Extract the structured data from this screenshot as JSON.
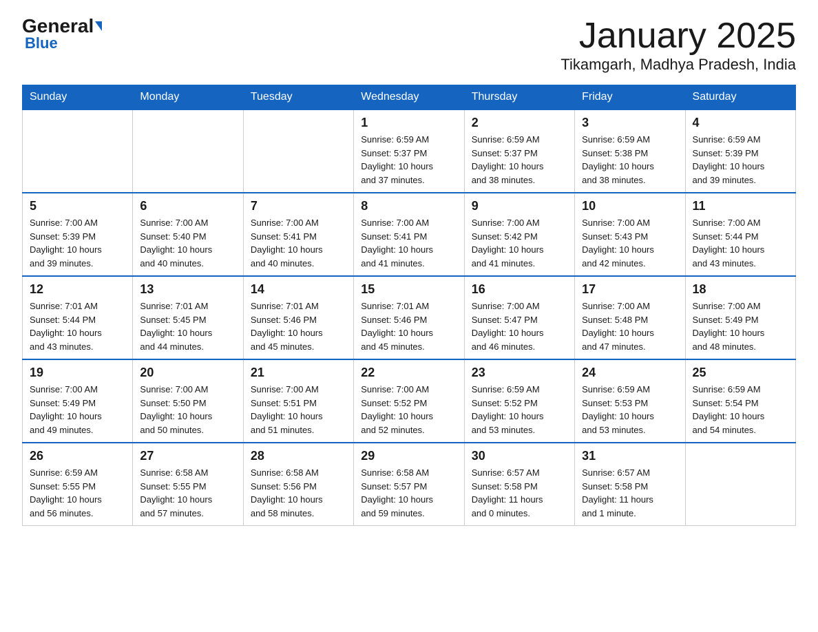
{
  "header": {
    "logo_general": "General",
    "logo_blue": "Blue",
    "title": "January 2025",
    "subtitle": "Tikamgarh, Madhya Pradesh, India"
  },
  "days_of_week": [
    "Sunday",
    "Monday",
    "Tuesday",
    "Wednesday",
    "Thursday",
    "Friday",
    "Saturday"
  ],
  "weeks": [
    [
      {
        "day": "",
        "info": ""
      },
      {
        "day": "",
        "info": ""
      },
      {
        "day": "",
        "info": ""
      },
      {
        "day": "1",
        "info": "Sunrise: 6:59 AM\nSunset: 5:37 PM\nDaylight: 10 hours\nand 37 minutes."
      },
      {
        "day": "2",
        "info": "Sunrise: 6:59 AM\nSunset: 5:37 PM\nDaylight: 10 hours\nand 38 minutes."
      },
      {
        "day": "3",
        "info": "Sunrise: 6:59 AM\nSunset: 5:38 PM\nDaylight: 10 hours\nand 38 minutes."
      },
      {
        "day": "4",
        "info": "Sunrise: 6:59 AM\nSunset: 5:39 PM\nDaylight: 10 hours\nand 39 minutes."
      }
    ],
    [
      {
        "day": "5",
        "info": "Sunrise: 7:00 AM\nSunset: 5:39 PM\nDaylight: 10 hours\nand 39 minutes."
      },
      {
        "day": "6",
        "info": "Sunrise: 7:00 AM\nSunset: 5:40 PM\nDaylight: 10 hours\nand 40 minutes."
      },
      {
        "day": "7",
        "info": "Sunrise: 7:00 AM\nSunset: 5:41 PM\nDaylight: 10 hours\nand 40 minutes."
      },
      {
        "day": "8",
        "info": "Sunrise: 7:00 AM\nSunset: 5:41 PM\nDaylight: 10 hours\nand 41 minutes."
      },
      {
        "day": "9",
        "info": "Sunrise: 7:00 AM\nSunset: 5:42 PM\nDaylight: 10 hours\nand 41 minutes."
      },
      {
        "day": "10",
        "info": "Sunrise: 7:00 AM\nSunset: 5:43 PM\nDaylight: 10 hours\nand 42 minutes."
      },
      {
        "day": "11",
        "info": "Sunrise: 7:00 AM\nSunset: 5:44 PM\nDaylight: 10 hours\nand 43 minutes."
      }
    ],
    [
      {
        "day": "12",
        "info": "Sunrise: 7:01 AM\nSunset: 5:44 PM\nDaylight: 10 hours\nand 43 minutes."
      },
      {
        "day": "13",
        "info": "Sunrise: 7:01 AM\nSunset: 5:45 PM\nDaylight: 10 hours\nand 44 minutes."
      },
      {
        "day": "14",
        "info": "Sunrise: 7:01 AM\nSunset: 5:46 PM\nDaylight: 10 hours\nand 45 minutes."
      },
      {
        "day": "15",
        "info": "Sunrise: 7:01 AM\nSunset: 5:46 PM\nDaylight: 10 hours\nand 45 minutes."
      },
      {
        "day": "16",
        "info": "Sunrise: 7:00 AM\nSunset: 5:47 PM\nDaylight: 10 hours\nand 46 minutes."
      },
      {
        "day": "17",
        "info": "Sunrise: 7:00 AM\nSunset: 5:48 PM\nDaylight: 10 hours\nand 47 minutes."
      },
      {
        "day": "18",
        "info": "Sunrise: 7:00 AM\nSunset: 5:49 PM\nDaylight: 10 hours\nand 48 minutes."
      }
    ],
    [
      {
        "day": "19",
        "info": "Sunrise: 7:00 AM\nSunset: 5:49 PM\nDaylight: 10 hours\nand 49 minutes."
      },
      {
        "day": "20",
        "info": "Sunrise: 7:00 AM\nSunset: 5:50 PM\nDaylight: 10 hours\nand 50 minutes."
      },
      {
        "day": "21",
        "info": "Sunrise: 7:00 AM\nSunset: 5:51 PM\nDaylight: 10 hours\nand 51 minutes."
      },
      {
        "day": "22",
        "info": "Sunrise: 7:00 AM\nSunset: 5:52 PM\nDaylight: 10 hours\nand 52 minutes."
      },
      {
        "day": "23",
        "info": "Sunrise: 6:59 AM\nSunset: 5:52 PM\nDaylight: 10 hours\nand 53 minutes."
      },
      {
        "day": "24",
        "info": "Sunrise: 6:59 AM\nSunset: 5:53 PM\nDaylight: 10 hours\nand 53 minutes."
      },
      {
        "day": "25",
        "info": "Sunrise: 6:59 AM\nSunset: 5:54 PM\nDaylight: 10 hours\nand 54 minutes."
      }
    ],
    [
      {
        "day": "26",
        "info": "Sunrise: 6:59 AM\nSunset: 5:55 PM\nDaylight: 10 hours\nand 56 minutes."
      },
      {
        "day": "27",
        "info": "Sunrise: 6:58 AM\nSunset: 5:55 PM\nDaylight: 10 hours\nand 57 minutes."
      },
      {
        "day": "28",
        "info": "Sunrise: 6:58 AM\nSunset: 5:56 PM\nDaylight: 10 hours\nand 58 minutes."
      },
      {
        "day": "29",
        "info": "Sunrise: 6:58 AM\nSunset: 5:57 PM\nDaylight: 10 hours\nand 59 minutes."
      },
      {
        "day": "30",
        "info": "Sunrise: 6:57 AM\nSunset: 5:58 PM\nDaylight: 11 hours\nand 0 minutes."
      },
      {
        "day": "31",
        "info": "Sunrise: 6:57 AM\nSunset: 5:58 PM\nDaylight: 11 hours\nand 1 minute."
      },
      {
        "day": "",
        "info": ""
      }
    ]
  ]
}
